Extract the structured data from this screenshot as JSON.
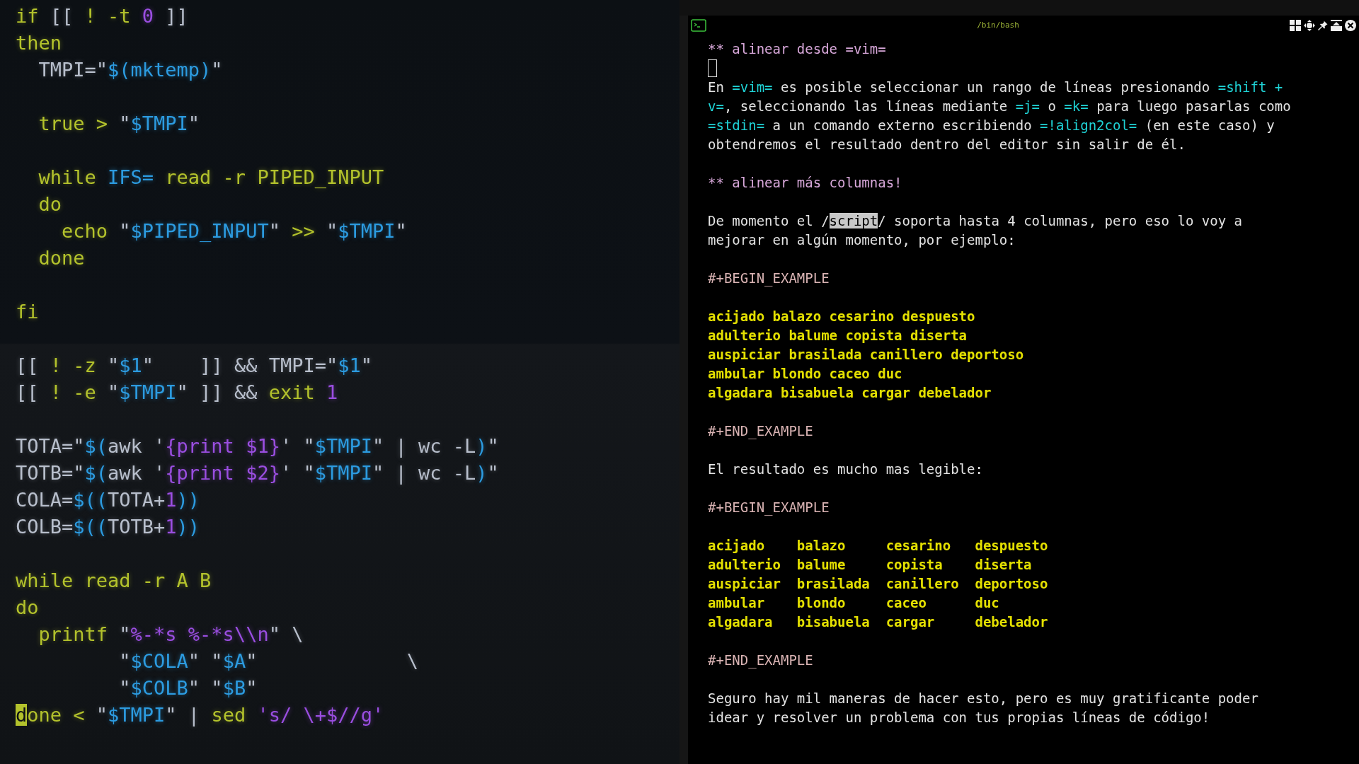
{
  "editor_pane": {
    "blocks": [
      [
        [
          {
            "kind": "kw",
            "text": "if "
          },
          {
            "kind": "plain",
            "text": "[[ "
          },
          {
            "kind": "kw",
            "text": "! -t "
          },
          {
            "kind": "num",
            "text": "0"
          },
          {
            "kind": "plain",
            "text": " ]]"
          }
        ],
        [
          {
            "kind": "kw",
            "text": "then"
          }
        ],
        [
          {
            "kind": "plain",
            "text": "  TMPI=\""
          },
          {
            "kind": "str",
            "text": "$(mktemp)"
          },
          {
            "kind": "plain",
            "text": "\""
          }
        ]
      ],
      [
        [
          {
            "kind": "kw",
            "text": "  true > "
          },
          {
            "kind": "plain",
            "text": "\""
          },
          {
            "kind": "str",
            "text": "$TMPI"
          },
          {
            "kind": "plain",
            "text": "\""
          }
        ]
      ],
      [
        [
          {
            "kind": "kw",
            "text": "  while "
          },
          {
            "kind": "str",
            "text": "IFS="
          },
          {
            "kind": "kw",
            "text": " read -r PIPED_INPUT"
          }
        ],
        [
          {
            "kind": "kw",
            "text": "  do"
          }
        ],
        [
          {
            "kind": "kw",
            "text": "    echo "
          },
          {
            "kind": "plain",
            "text": "\""
          },
          {
            "kind": "str",
            "text": "$PIPED_INPUT"
          },
          {
            "kind": "plain",
            "text": "\""
          },
          {
            "kind": "kw",
            "text": " >> "
          },
          {
            "kind": "plain",
            "text": "\""
          },
          {
            "kind": "str",
            "text": "$TMPI"
          },
          {
            "kind": "plain",
            "text": "\""
          }
        ],
        [
          {
            "kind": "kw",
            "text": "  done"
          }
        ]
      ],
      [
        [
          {
            "kind": "kw",
            "text": "fi"
          }
        ]
      ],
      [
        [
          {
            "kind": "plain",
            "text": "[[ "
          },
          {
            "kind": "kw",
            "text": "! -z "
          },
          {
            "kind": "plain",
            "text": "\""
          },
          {
            "kind": "str",
            "text": "$1"
          },
          {
            "kind": "plain",
            "text": "\"    ]] && TMPI=\""
          },
          {
            "kind": "str",
            "text": "$1"
          },
          {
            "kind": "plain",
            "text": "\""
          }
        ],
        [
          {
            "kind": "plain",
            "text": "[[ "
          },
          {
            "kind": "kw",
            "text": "! -e "
          },
          {
            "kind": "plain",
            "text": "\""
          },
          {
            "kind": "str",
            "text": "$TMPI"
          },
          {
            "kind": "plain",
            "text": "\" ]] && "
          },
          {
            "kind": "kw",
            "text": "exit "
          },
          {
            "kind": "num",
            "text": "1"
          }
        ]
      ],
      [
        [
          {
            "kind": "plain",
            "text": "TOTA=\""
          },
          {
            "kind": "str",
            "text": "$("
          },
          {
            "kind": "plain",
            "text": "awk '"
          },
          {
            "kind": "num",
            "text": "{print $1}"
          },
          {
            "kind": "plain",
            "text": "' \""
          },
          {
            "kind": "str",
            "text": "$TMPI"
          },
          {
            "kind": "plain",
            "text": "\" | wc -L"
          },
          {
            "kind": "str",
            "text": ")"
          },
          {
            "kind": "plain",
            "text": "\""
          }
        ],
        [
          {
            "kind": "plain",
            "text": "TOTB=\""
          },
          {
            "kind": "str",
            "text": "$("
          },
          {
            "kind": "plain",
            "text": "awk '"
          },
          {
            "kind": "num",
            "text": "{print $2}"
          },
          {
            "kind": "plain",
            "text": "' \""
          },
          {
            "kind": "str",
            "text": "$TMPI"
          },
          {
            "kind": "plain",
            "text": "\" | wc -L"
          },
          {
            "kind": "str",
            "text": ")"
          },
          {
            "kind": "plain",
            "text": "\""
          }
        ],
        [
          {
            "kind": "plain",
            "text": "COLA="
          },
          {
            "kind": "str",
            "text": "$(("
          },
          {
            "kind": "plain",
            "text": "TOTA+"
          },
          {
            "kind": "num",
            "text": "1"
          },
          {
            "kind": "str",
            "text": "))"
          }
        ],
        [
          {
            "kind": "plain",
            "text": "COLB="
          },
          {
            "kind": "str",
            "text": "$(("
          },
          {
            "kind": "plain",
            "text": "TOTB+"
          },
          {
            "kind": "num",
            "text": "1"
          },
          {
            "kind": "str",
            "text": "))"
          }
        ]
      ],
      [
        [
          {
            "kind": "kw",
            "text": "while read -r A B"
          }
        ],
        [
          {
            "kind": "kw",
            "text": "do"
          }
        ],
        [
          {
            "kind": "kw",
            "text": "  printf "
          },
          {
            "kind": "plain",
            "text": "\""
          },
          {
            "kind": "num",
            "text": "%-*s %-*s\\\\n"
          },
          {
            "kind": "plain",
            "text": "\" \\"
          }
        ],
        [
          {
            "kind": "plain",
            "text": "         \""
          },
          {
            "kind": "str",
            "text": "$COLA"
          },
          {
            "kind": "plain",
            "text": "\" \""
          },
          {
            "kind": "str",
            "text": "$A"
          },
          {
            "kind": "plain",
            "text": "\"             \\"
          }
        ],
        [
          {
            "kind": "plain",
            "text": "         \""
          },
          {
            "kind": "str",
            "text": "$COLB"
          },
          {
            "kind": "plain",
            "text": "\" \""
          },
          {
            "kind": "str",
            "text": "$B"
          },
          {
            "kind": "plain",
            "text": "\""
          }
        ],
        [
          {
            "kind": "cursor",
            "text": "d"
          },
          {
            "kind": "kw",
            "text": "one < "
          },
          {
            "kind": "plain",
            "text": "\""
          },
          {
            "kind": "str",
            "text": "$TMPI"
          },
          {
            "kind": "plain",
            "text": "\" | "
          },
          {
            "kind": "kw",
            "text": "sed "
          },
          {
            "kind": "num",
            "text": "'s/ \\+$//g'"
          }
        ]
      ]
    ]
  },
  "terminal_pane": {
    "title": "/bin/bash",
    "blocks": [
      [
        {
          "kind": "heading",
          "segments": [
            {
              "kind": "text",
              "text": "** alinear desde =vim="
            }
          ]
        },
        {
          "kind": "cursor"
        },
        {
          "kind": "paragraph",
          "segments": [
            {
              "kind": "text",
              "text": "En "
            },
            {
              "kind": "code",
              "text": "=vim="
            },
            {
              "kind": "text",
              "text": " es posible seleccionar un rango de líneas presionando "
            },
            {
              "kind": "code",
              "text": "=shift + v="
            },
            {
              "kind": "text",
              "text": ", seleccionando las líneas mediante "
            },
            {
              "kind": "code",
              "text": "=j="
            },
            {
              "kind": "text",
              "text": " o "
            },
            {
              "kind": "code",
              "text": "=k="
            },
            {
              "kind": "text",
              "text": " para luego pasarlas como "
            },
            {
              "kind": "code",
              "text": "=stdin="
            },
            {
              "kind": "text",
              "text": " a un comando externo escribiendo "
            },
            {
              "kind": "code",
              "text": "=!align2col="
            },
            {
              "kind": "text",
              "text": " (en este caso) y obtendremos el resultado dentro del editor sin salir de él."
            }
          ]
        }
      ],
      [
        {
          "kind": "heading",
          "segments": [
            {
              "kind": "text",
              "text": "** alinear más columnas!"
            }
          ]
        }
      ],
      [
        {
          "kind": "paragraph",
          "segments": [
            {
              "kind": "text",
              "text": "De momento el /"
            },
            {
              "kind": "selection",
              "text": "script"
            },
            {
              "kind": "text",
              "text": "/ soporta hasta 4 columnas, pero eso lo voy a mejorar en algún momento, por ejemplo:"
            }
          ]
        }
      ],
      [
        {
          "kind": "marker",
          "segments": [
            {
              "kind": "text",
              "text": "#+BEGIN_EXAMPLE"
            }
          ]
        }
      ],
      [
        {
          "kind": "example",
          "segments": [
            {
              "kind": "text",
              "text": "acijado balazo cesarino despuesto"
            }
          ]
        },
        {
          "kind": "example",
          "segments": [
            {
              "kind": "text",
              "text": "adulterio balume copista diserta"
            }
          ]
        },
        {
          "kind": "example",
          "segments": [
            {
              "kind": "text",
              "text": "auspiciar brasilada canillero deportoso"
            }
          ]
        },
        {
          "kind": "example",
          "segments": [
            {
              "kind": "text",
              "text": "ambular blondo caceo duc"
            }
          ]
        },
        {
          "kind": "example",
          "segments": [
            {
              "kind": "text",
              "text": "algadara bisabuela cargar debelador"
            }
          ]
        }
      ],
      [
        {
          "kind": "marker",
          "segments": [
            {
              "kind": "text",
              "text": "#+END_EXAMPLE"
            }
          ]
        }
      ],
      [
        {
          "kind": "paragraph",
          "segments": [
            {
              "kind": "text",
              "text": "El resultado es mucho mas legible:"
            }
          ]
        }
      ],
      [
        {
          "kind": "marker",
          "segments": [
            {
              "kind": "text",
              "text": "#+BEGIN_EXAMPLE"
            }
          ]
        }
      ],
      [
        {
          "kind": "example",
          "segments": [
            {
              "kind": "text",
              "text": "acijado    balazo     cesarino   despuesto"
            }
          ]
        },
        {
          "kind": "example",
          "segments": [
            {
              "kind": "text",
              "text": "adulterio  balume     copista    diserta"
            }
          ]
        },
        {
          "kind": "example",
          "segments": [
            {
              "kind": "text",
              "text": "auspiciar  brasilada  canillero  deportoso"
            }
          ]
        },
        {
          "kind": "example",
          "segments": [
            {
              "kind": "text",
              "text": "ambular    blondo     caceo      duc"
            }
          ]
        },
        {
          "kind": "example",
          "segments": [
            {
              "kind": "text",
              "text": "algadara   bisabuela  cargar     debelador"
            }
          ]
        }
      ],
      [
        {
          "kind": "marker",
          "segments": [
            {
              "kind": "text",
              "text": "#+END_EXAMPLE"
            }
          ]
        }
      ],
      [
        {
          "kind": "paragraph",
          "segments": [
            {
              "kind": "text",
              "text": "Seguro hay mil maneras de hacer esto, pero es muy gratificante poder idear y resolver un problema con tus propias líneas de código!"
            }
          ]
        }
      ]
    ]
  }
}
